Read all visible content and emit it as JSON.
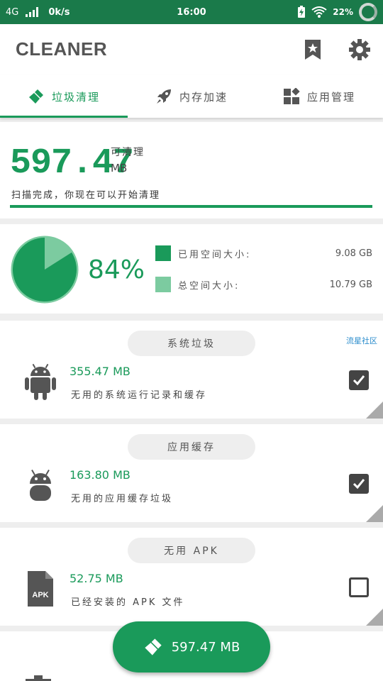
{
  "status_bar": {
    "network": "4G",
    "speed": "0k/s",
    "time": "16:00",
    "battery": "22%"
  },
  "app_bar": {
    "title": "CLEANER"
  },
  "tabs": [
    {
      "label": "垃圾清理",
      "icon": "broom-icon",
      "active": true
    },
    {
      "label": "内存加速",
      "icon": "rocket-icon",
      "active": false
    },
    {
      "label": "应用管理",
      "icon": "apps-icon",
      "active": false
    }
  ],
  "summary": {
    "size": "597.47",
    "label": "可清理",
    "unit": "MB",
    "message": "扫描完成，你现在可以开始清理",
    "progress": 1.0
  },
  "storage": {
    "percent": "84%",
    "used_fraction": 0.84,
    "used_label": "已用空间大小:",
    "used_value": "9.08 GB",
    "total_label": "总空间大小:",
    "total_value": "10.79 GB",
    "used_color": "#1a9a5a",
    "free_color": "#7ccba0"
  },
  "watermark": "流星社区",
  "items": [
    {
      "title": "系统垃圾",
      "size": "355.47 MB",
      "desc": "无用的系统运行记录和缓存",
      "checked": true,
      "icon": "android-icon"
    },
    {
      "title": "应用缓存",
      "size": "163.80 MB",
      "desc": "无用的应用缓存垃圾",
      "checked": true,
      "icon": "android-head-icon"
    },
    {
      "title": "无用 APK",
      "size": "52.75 MB",
      "desc": "已经安装的 APK 文件",
      "checked": false,
      "icon": "apk-file-icon"
    }
  ],
  "fab": {
    "label": "597.47 MB"
  },
  "colors": {
    "primary": "#1a9a5a",
    "status_bar": "#1a7a4a"
  }
}
